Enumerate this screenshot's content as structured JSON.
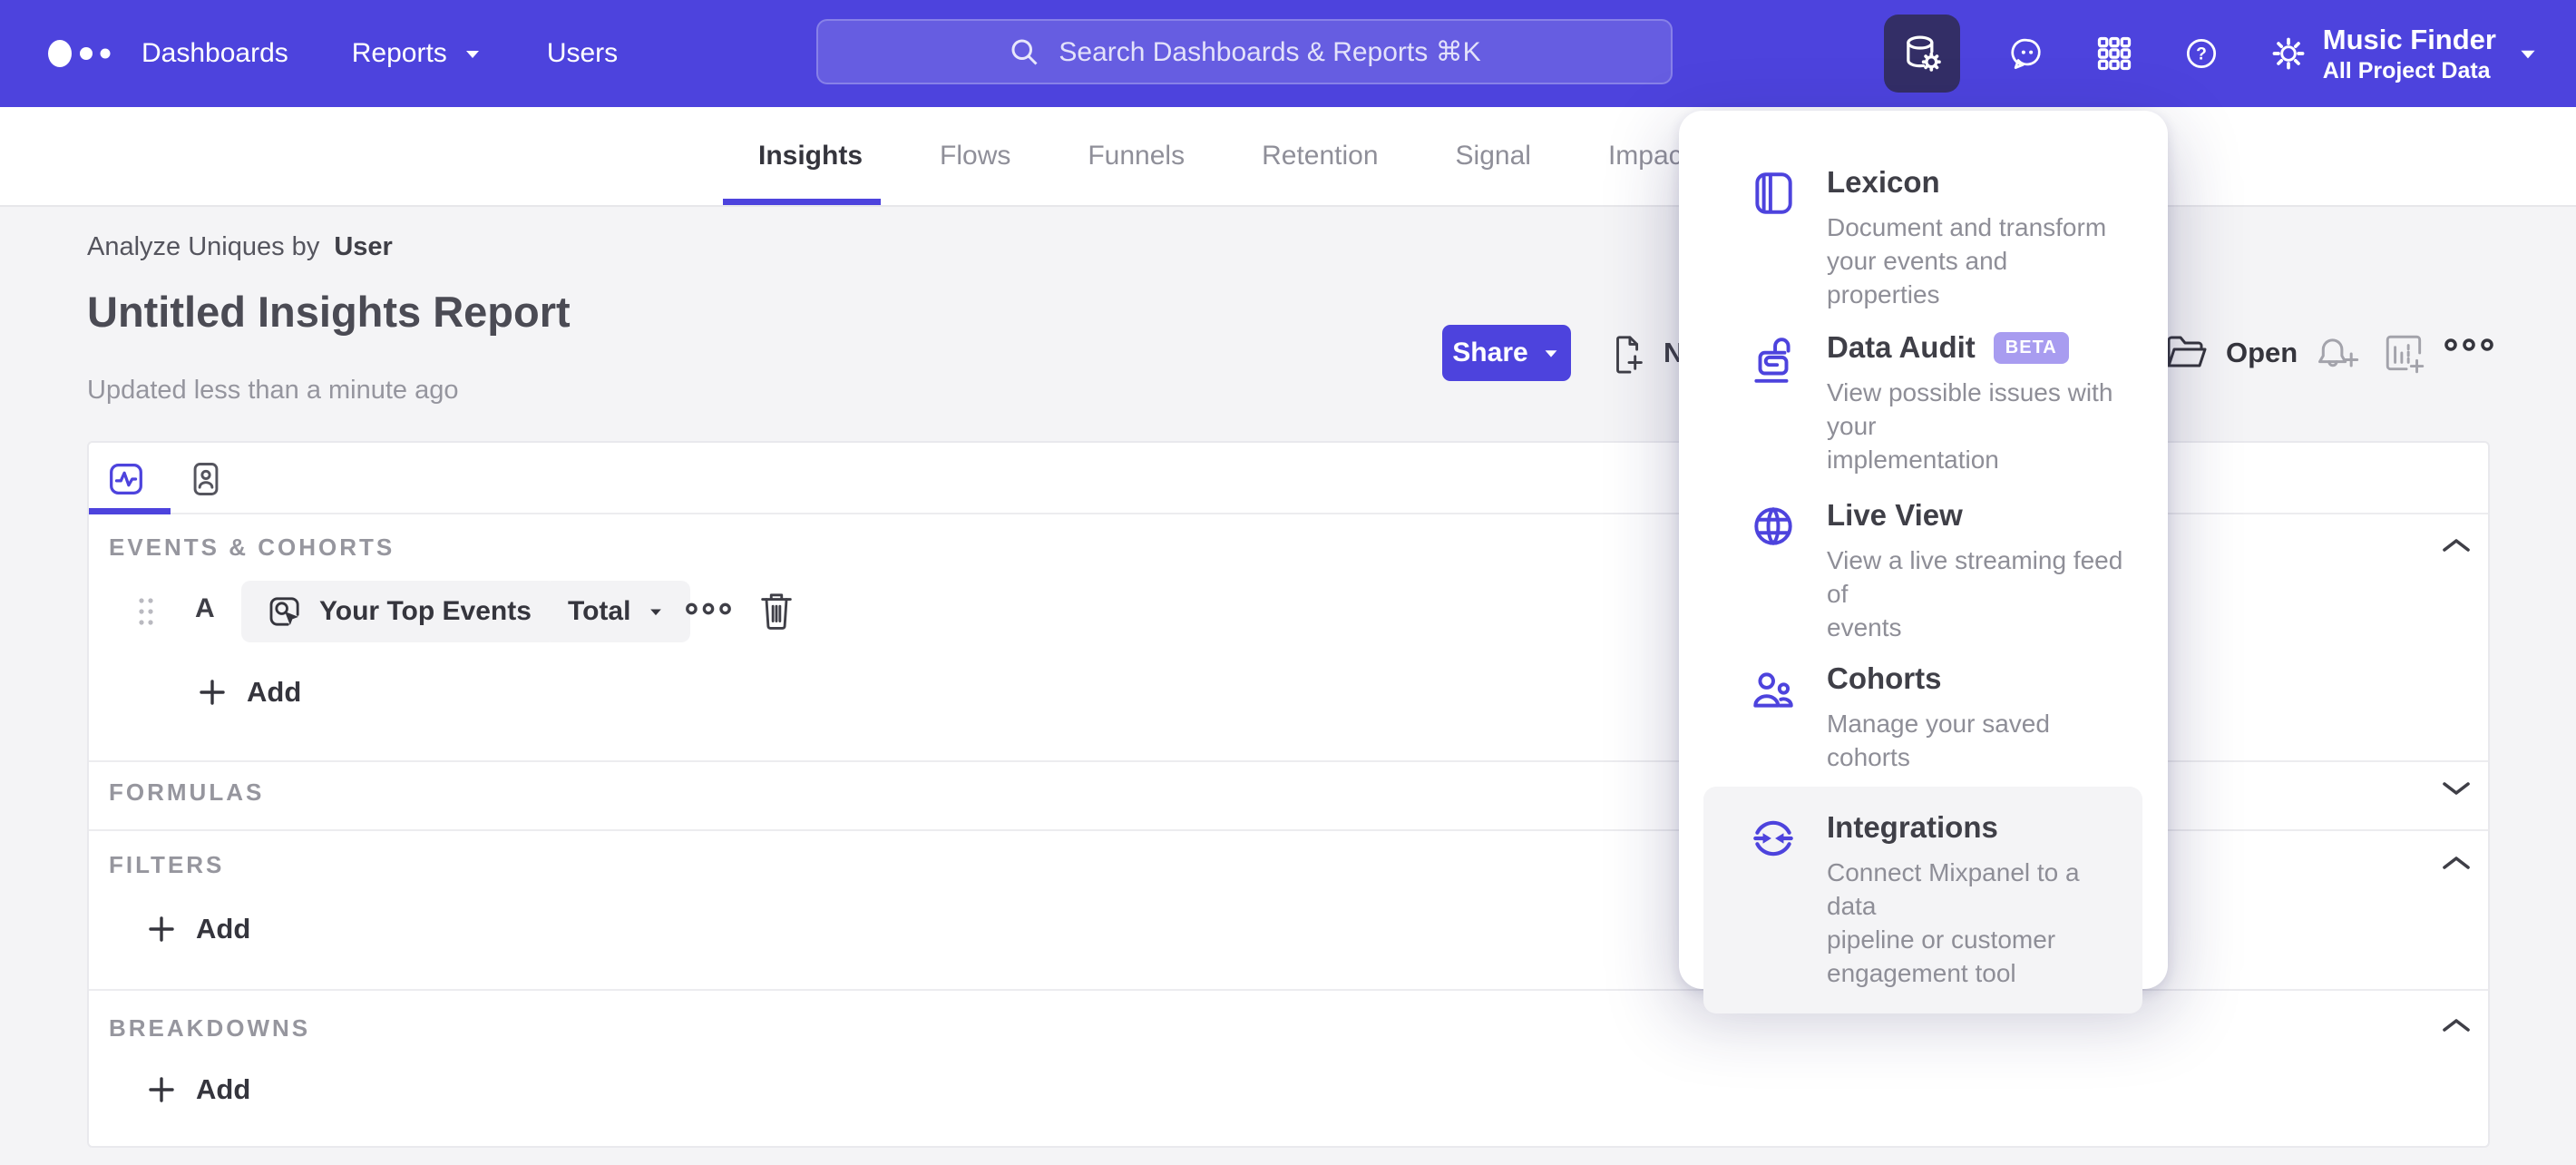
{
  "nav": {
    "links": [
      {
        "label": "Dashboards"
      },
      {
        "label": "Reports"
      },
      {
        "label": "Users"
      }
    ],
    "search_placeholder": "Search Dashboards & Reports ⌘K",
    "project": {
      "name": "Music Finder",
      "scope": "All Project Data"
    },
    "right_icons": [
      "data-management-icon",
      "messages-icon",
      "apps-grid-icon",
      "help-icon",
      "settings-icon"
    ]
  },
  "report_tabs": {
    "active": "Insights",
    "items": [
      {
        "label": "Insights"
      },
      {
        "label": "Flows"
      },
      {
        "label": "Funnels"
      },
      {
        "label": "Retention"
      },
      {
        "label": "Signal"
      },
      {
        "label": "Impact"
      }
    ]
  },
  "header": {
    "analyze_prefix": "Analyze Uniques by",
    "analyze_value": "User",
    "title": "Untitled Insights Report",
    "updated": "Updated less than a minute ago"
  },
  "actions": {
    "share": "Share",
    "new": "New",
    "open": "Open"
  },
  "builder": {
    "sections": {
      "events": {
        "title": "EVENTS & COHORTS",
        "state": "expanded"
      },
      "formulas": {
        "title": "FORMULAS",
        "state": "collapsed"
      },
      "filters": {
        "title": "FILTERS",
        "state": "expanded"
      },
      "breakdowns": {
        "title": "BREAKDOWNS",
        "state": "expanded"
      }
    },
    "event_row": {
      "letter": "A",
      "event": "Your Top Events",
      "metric": "Total"
    },
    "add_label": "Add"
  },
  "menu": {
    "items": [
      {
        "title": "Lexicon",
        "description": "Document and transform\nyour events and properties",
        "icon": "book-icon"
      },
      {
        "title": "Data Audit",
        "badge": "BETA",
        "description": "View possible issues with your\nimplementation",
        "icon": "open-lock-icon"
      },
      {
        "title": "Live View",
        "description": "View a live streaming feed of\nevents",
        "icon": "globe-icon"
      },
      {
        "title": "Cohorts",
        "description": "Manage your saved cohorts",
        "icon": "people-icon"
      },
      {
        "title": "Integrations",
        "description": "Connect Mixpanel to a data\npipeline or customer\nengagement tool",
        "icon": "sync-arrows-icon",
        "highlighted": true
      }
    ]
  },
  "colors": {
    "accent": "#4d43dd",
    "navbar": "#4d43dd",
    "active_tile": "#332e66",
    "beta_badge": "#a89cf0",
    "text_dark": "#3f3f47",
    "text_muted": "#8e8e97",
    "page_bg": "#f4f4f6"
  }
}
